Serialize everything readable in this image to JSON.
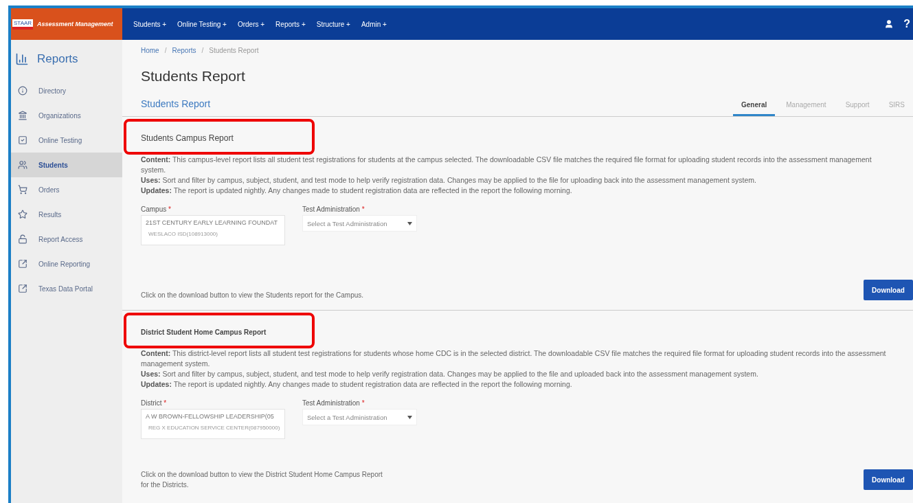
{
  "app": {
    "logo_badge": "STAAR",
    "title": "Assessment Management"
  },
  "nav": [
    {
      "label": "Students +"
    },
    {
      "label": "Online Testing +"
    },
    {
      "label": "Orders +"
    },
    {
      "label": "Reports +"
    },
    {
      "label": "Structure +"
    },
    {
      "label": "Admin +"
    }
  ],
  "header_actions": [
    {
      "kind": "user"
    },
    {
      "kind": "help",
      "label": "?"
    }
  ],
  "sidebar": {
    "title": "Reports",
    "items": [
      {
        "label": "Directory",
        "kind": "info",
        "selected": false
      },
      {
        "label": "Organizations",
        "kind": "building",
        "selected": false
      },
      {
        "label": "Online Testing",
        "kind": "check",
        "selected": false
      },
      {
        "label": "Students",
        "kind": "users",
        "selected": true
      },
      {
        "label": "Orders",
        "kind": "cart",
        "selected": false
      },
      {
        "label": "Results",
        "kind": "star",
        "selected": false
      },
      {
        "label": "Report Access",
        "kind": "lock",
        "selected": false
      },
      {
        "label": "Online Reporting",
        "kind": "external",
        "selected": false
      },
      {
        "label": "Texas Data Portal",
        "kind": "external",
        "selected": false
      }
    ]
  },
  "breadcrumb": [
    "Home",
    "Reports",
    "Students Report"
  ],
  "breadcrumb_separator": "/",
  "page_title": "Students Report",
  "subtitle": "Students Report",
  "tabs": [
    {
      "label": "General",
      "selected": true
    },
    {
      "label": "Management",
      "selected": false
    },
    {
      "label": "Support",
      "selected": false
    },
    {
      "label": "SIRS",
      "selected": false
    }
  ],
  "sections": [
    {
      "title": "Students Campus Report",
      "bold_title": false,
      "highlighted": true,
      "description": [
        "**Content:** This campus-level report lists all student test registrations for students at the campus selected. The downloadable CSV file matches the required file format for uploading student records into the assessment management system.",
        "**Uses:** Sort and filter by campus, subject, student, and test mode to help verify registration data. Changes may be applied to the file for uploading back into the assessment management system.",
        "**Updates:** The report is updated nightly. Any changes made to student registration data are reflected in the report the following morning."
      ],
      "fields": [
        {
          "kind": "org",
          "label": "Campus",
          "required": "*",
          "value": "21ST CENTURY EARLY LEARNING FOUNDAT",
          "detail": "WESLACO ISD(108913000)"
        },
        {
          "kind": "select",
          "label": "Test Administration",
          "required": "*",
          "placeholder": "Select a Test Administration"
        }
      ],
      "note": "Click on the download button to view the Students report for the Campus.",
      "button": "Download"
    },
    {
      "title": "District Student Home Campus Report",
      "bold_title": true,
      "highlighted": true,
      "description": [
        "**Content:** This district-level report lists all student test registrations for students whose home CDC is in the selected district. The downloadable CSV file matches the required file format for uploading student records into the assessment management system.",
        "**Uses:** Sort and filter by campus, subject, student, and test mode to help verify registration data. Changes may be applied to the file and uploaded back into the assessment management system.",
        "**Updates:** The report is updated nightly. Any changes made to student registration data are reflected in the report the following morning."
      ],
      "fields": [
        {
          "kind": "org",
          "label": "District",
          "required": "*",
          "value": "A W BROWN-FELLOWSHIP LEADERSHIP(05",
          "detail": "REG X EDUCATION SERVICE CENTER(087950000)"
        },
        {
          "kind": "select",
          "label": "Test Administration",
          "required": "*",
          "placeholder": "Select a Test Administration"
        }
      ],
      "note": "Click on the download button to view the District Student Home Campus Report for the Districts.",
      "button": "Download"
    }
  ]
}
